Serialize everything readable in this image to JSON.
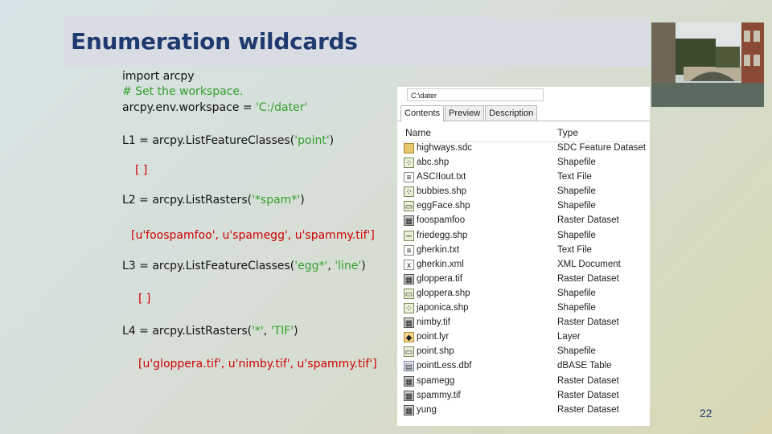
{
  "slide": {
    "title": "Enumeration wildcards",
    "page_number": "22"
  },
  "code": {
    "line1": "import arcpy",
    "comment": "# Set the workspace.",
    "ws_prefix": "arcpy.env.workspace = ",
    "ws_value": "'C:/dater'",
    "l1_prefix": "L1 = arcpy.ListFeatureClasses(",
    "l1_arg": "'point'",
    "l1_suffix": ")",
    "l1_result": "[ ]",
    "l2_prefix": "L2 = arcpy.ListRasters(",
    "l2_arg": "'*spam*'",
    "l2_suffix": ")",
    "l2_result": "[u'foospamfoo', u'spamegg', u'spammy.tif']",
    "l3_prefix": "L3 = arcpy.ListFeatureClasses(",
    "l3_arg1": "'egg*'",
    "l3_sep": ", ",
    "l3_arg2": "'line'",
    "l3_suffix": ")",
    "l3_result": "[ ]",
    "l4_prefix": "L4 = arcpy.ListRasters(",
    "l4_arg1": "'*'",
    "l4_sep": ", ",
    "l4_arg2": "'TIF'",
    "l4_suffix": ")",
    "l4_result": "[u'gloppera.tif', u'nimby.tif', u'spammy.tif']"
  },
  "catalog": {
    "path": "C:\\dater",
    "tabs": [
      "Contents",
      "Preview",
      "Description"
    ],
    "col_name": "Name",
    "col_type": "Type",
    "rows": [
      {
        "name": "highways.sdc",
        "type": "SDC Feature Dataset",
        "icon": "folder-icon"
      },
      {
        "name": "abc.shp",
        "type": "Shapefile",
        "icon": "point-shapefile-icon"
      },
      {
        "name": "ASCIIout.txt",
        "type": "Text File",
        "icon": "text-file-icon"
      },
      {
        "name": "bubbies.shp",
        "type": "Shapefile",
        "icon": "point-shapefile-icon"
      },
      {
        "name": "eggFace.shp",
        "type": "Shapefile",
        "icon": "polygon-shapefile-icon"
      },
      {
        "name": "foospamfoo",
        "type": "Raster Dataset",
        "icon": "raster-icon"
      },
      {
        "name": "friedegg.shp",
        "type": "Shapefile",
        "icon": "line-shapefile-icon"
      },
      {
        "name": "gherkin.txt",
        "type": "Text File",
        "icon": "text-file-icon"
      },
      {
        "name": "gherkin.xml",
        "type": "XML Document",
        "icon": "xml-icon"
      },
      {
        "name": "gloppera.tif",
        "type": "Raster Dataset",
        "icon": "raster-icon"
      },
      {
        "name": "gloppera.shp",
        "type": "Shapefile",
        "icon": "polygon-shapefile-icon"
      },
      {
        "name": "japonica.shp",
        "type": "Shapefile",
        "icon": "point-shapefile-icon"
      },
      {
        "name": "nimby.tif",
        "type": "Raster Dataset",
        "icon": "raster-icon"
      },
      {
        "name": "point.lyr",
        "type": "Layer",
        "icon": "layer-icon"
      },
      {
        "name": "point.shp",
        "type": "Shapefile",
        "icon": "polygon-shapefile-icon"
      },
      {
        "name": "pointLess.dbf",
        "type": "dBASE Table",
        "icon": "table-icon"
      },
      {
        "name": "spamegg",
        "type": "Raster Dataset",
        "icon": "raster-icon"
      },
      {
        "name": "spammy.tif",
        "type": "Raster Dataset",
        "icon": "raster-icon"
      },
      {
        "name": "yung",
        "type": "Raster Dataset",
        "icon": "raster-icon"
      }
    ]
  },
  "colors": {
    "title": "#1f3a6e",
    "string": "#33a02c",
    "result": "#d00000"
  }
}
